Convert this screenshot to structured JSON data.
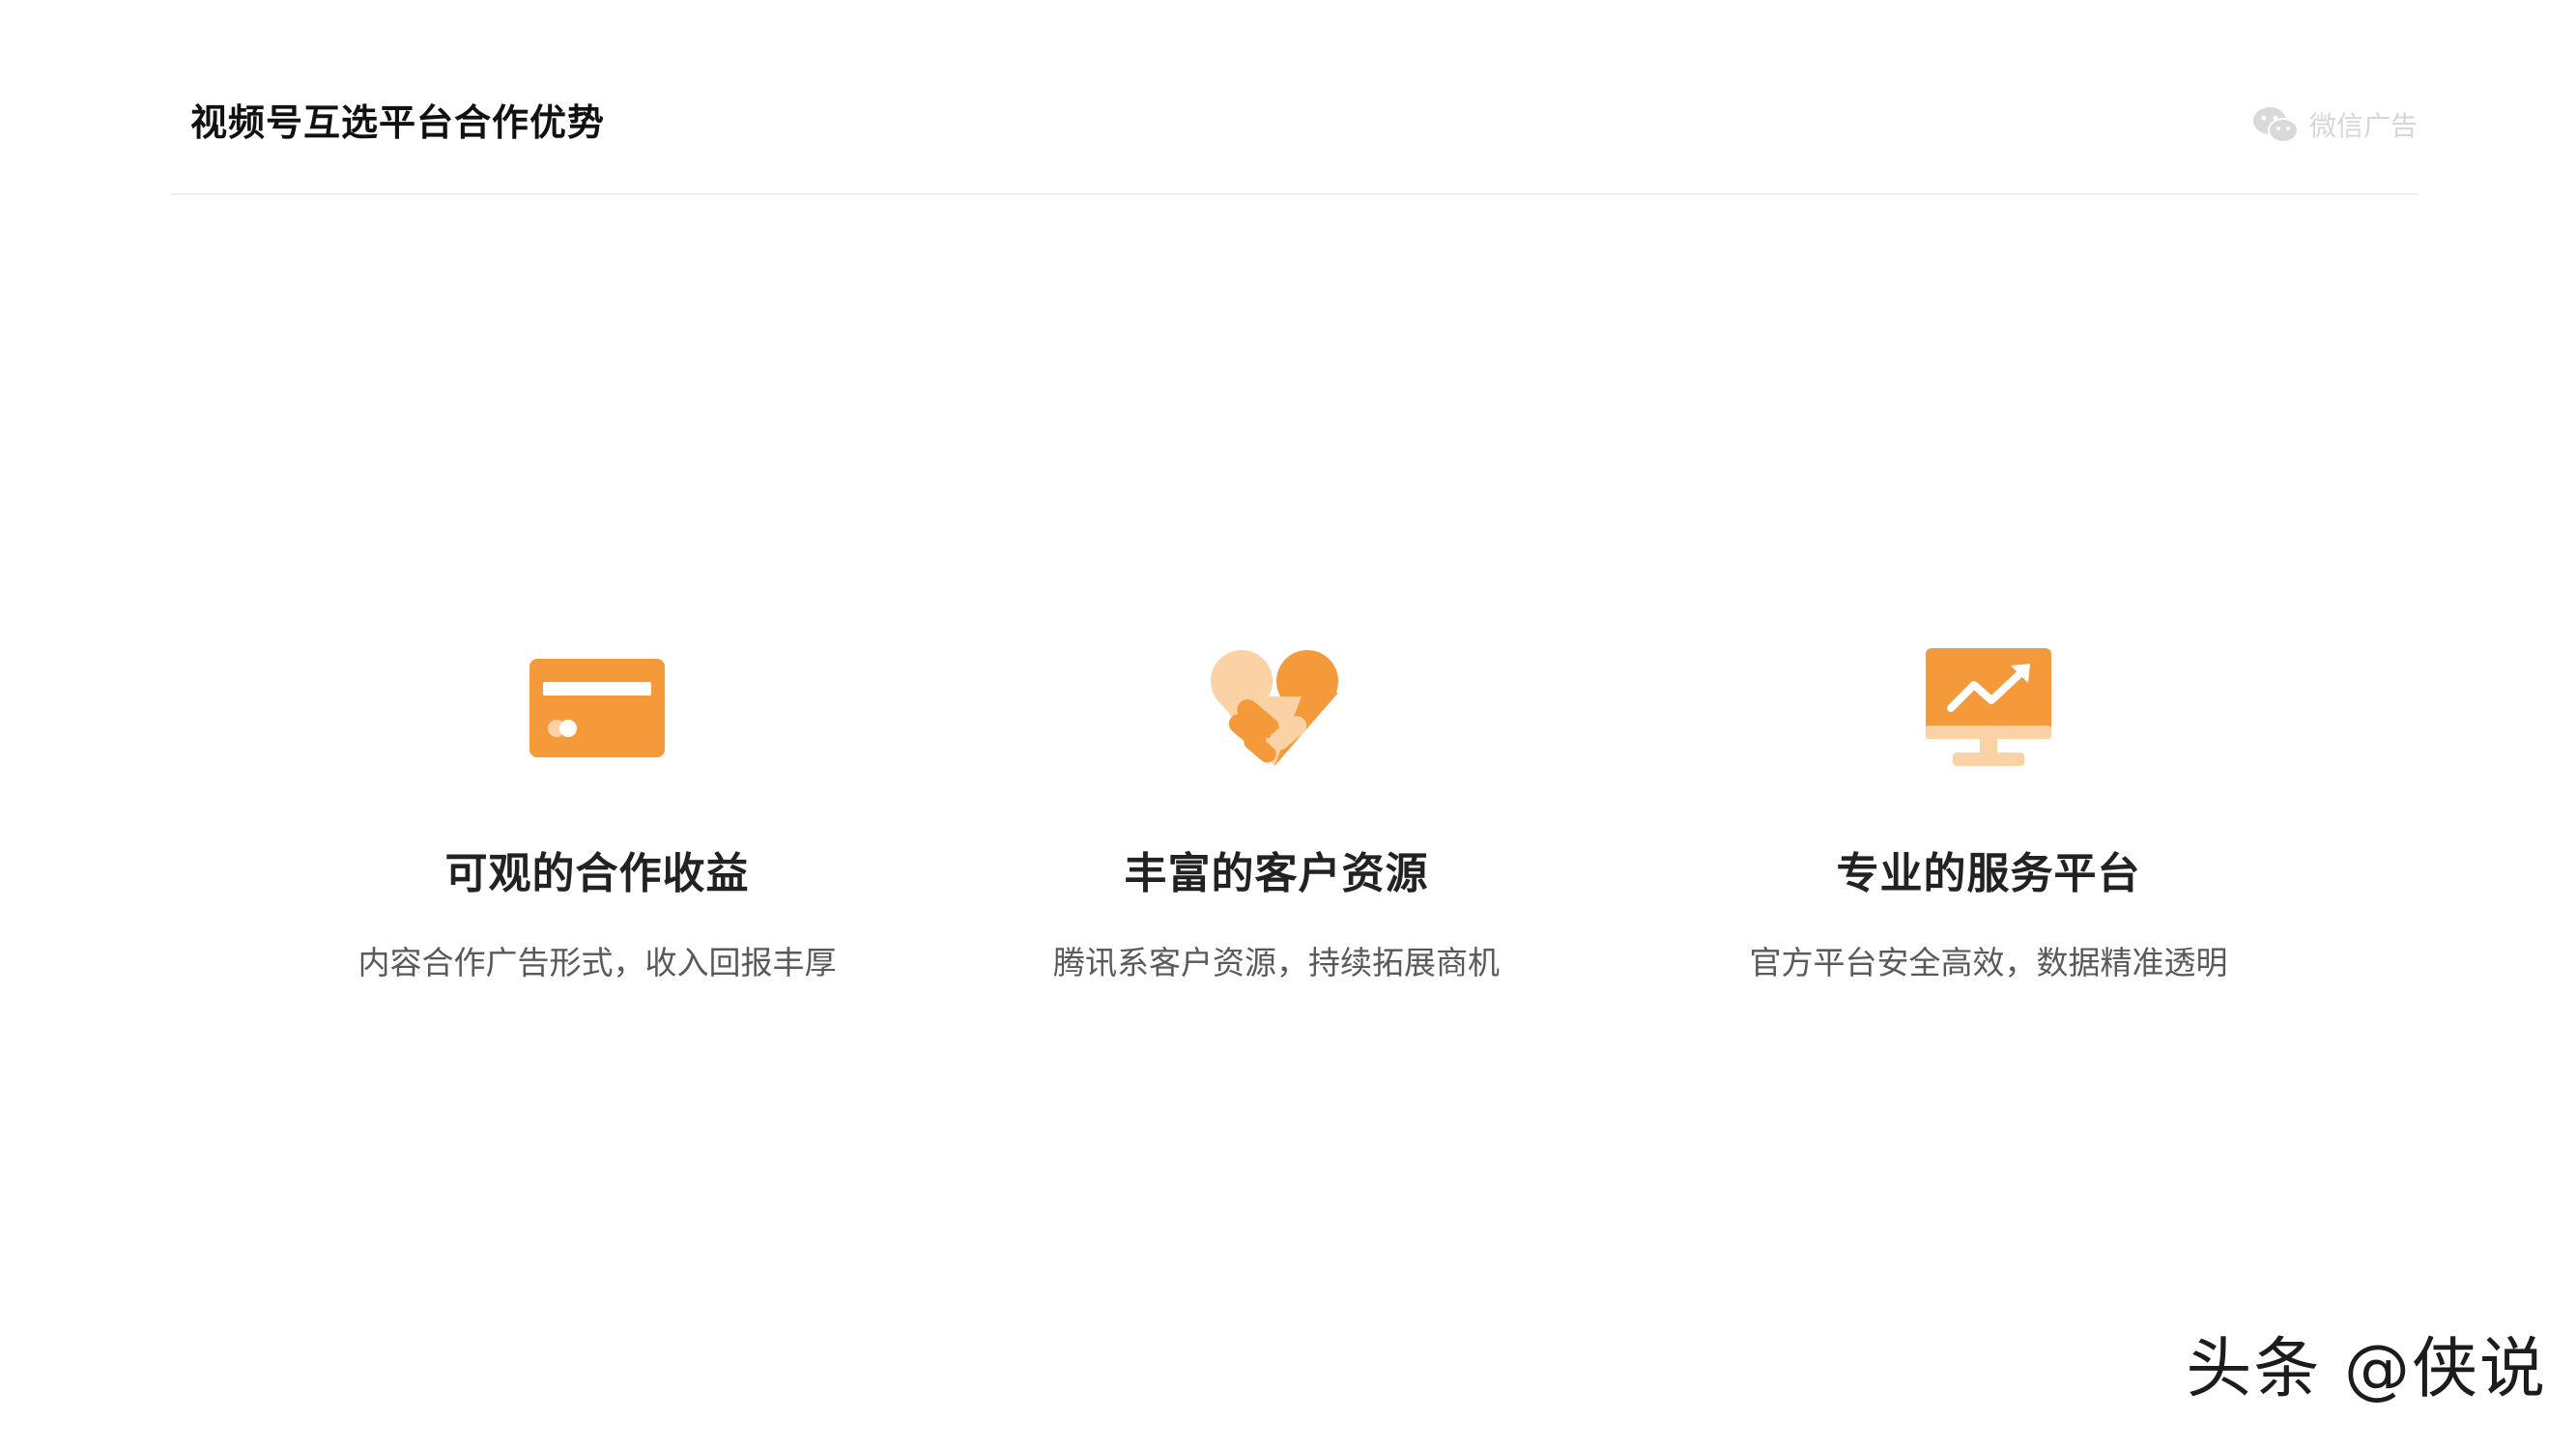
{
  "header": {
    "title": "视频号互选平台合作优势",
    "brand_label": "微信广告",
    "brand_icon": "wechat-icon"
  },
  "features": [
    {
      "icon": "credit-card-icon",
      "title": "可观的合作收益",
      "description": "内容合作广告形式，收入回报丰厚"
    },
    {
      "icon": "handshake-heart-icon",
      "title": "丰富的客户资源",
      "description": "腾讯系客户资源，持续拓展商机"
    },
    {
      "icon": "monitor-trend-icon",
      "title": "专业的服务平台",
      "description": "官方平台安全高效，数据精准透明"
    }
  ],
  "watermark": {
    "text": "头条 @侠说"
  },
  "colors": {
    "accent": "#F59A3A",
    "accent_light": "#FAD2A6",
    "brand_gray": "#D6D6D6"
  }
}
